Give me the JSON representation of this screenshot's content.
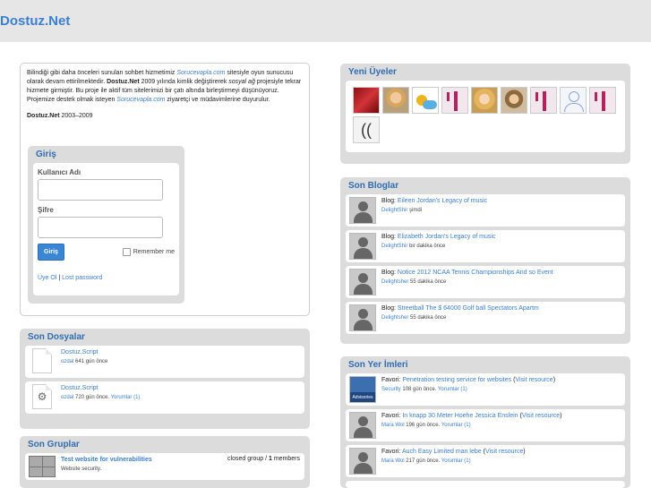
{
  "site": {
    "title": "Dostuz.Net"
  },
  "intro": {
    "p1_a": "Bilindiği gibi daha önceleri sunulan sohbet hizmetimiz ",
    "p1_link1": "Sorucevapla.com",
    "p1_b": " sitesiyle oyun sunucusu olarak devam ettirilmektedir. ",
    "p1_bold": "Dostuz.Net",
    "p1_c": " 2009 yılında kimlik değiştirerek ",
    "p1_em": "sosyal ağ",
    "p1_d": " projesiyle tekrar hizmete girmiştir. Bu proje ile aktif tüm sitelerimizi bir çatı altında birleştirmeyi düşünüyoruz. Projemize destek olmak isteyen ",
    "p1_link2": "Sorucevapla.com",
    "p1_e": " ziyaretçi ve müdavimlerine duyurulur.",
    "sig_bold": "Dostuz.Net",
    "sig_years": " 2003–2009"
  },
  "login": {
    "title": "Giriş",
    "username_label": "Kullanıcı Adı",
    "password_label": "Şifre",
    "button": "Giriş",
    "remember": "Remember me",
    "register": "Üye Ol",
    "sep": " | ",
    "lost": "Lost password"
  },
  "files": {
    "title": "Son Dosyalar",
    "items": [
      {
        "name": "Dostuz.Script",
        "user": "ozdal",
        "time": " 641 gün önce",
        "comments": ""
      },
      {
        "name": "Dostuz.Script",
        "user": "ozdal",
        "time": " 720 gün önce. ",
        "comments": "Yorumlar (1)"
      }
    ]
  },
  "groups": {
    "title": "Son Gruplar",
    "items": [
      {
        "name": "Test website for vulnerabilities",
        "desc": "Website security.",
        "status": "closed group / ",
        "members_count": "1",
        "members_label": " members"
      }
    ]
  },
  "new_users": {
    "title": "Yeni Üyeler",
    "avatars": [
      "red-avatar",
      "woman-avatar",
      "sun-cloud-avatar",
      "pink-logo-avatar",
      "blonde-woman-avatar",
      "man-avatar",
      "pink-logo-avatar",
      "default-user-avatar",
      "pink-logo-avatar",
      "ear-avatar"
    ]
  },
  "blogs": {
    "title": "Son Bloglar",
    "items": [
      {
        "prefix": "Blog: ",
        "title": "Eileen Jordan's Legacy of music",
        "user": "DelightShir",
        "time": " şimdi"
      },
      {
        "prefix": "Blog: ",
        "title": "Elizabeth Jordan's Legacy of music",
        "user": "DelightShir",
        "time": " bir dakika önce"
      },
      {
        "prefix": "Blog: ",
        "title": "Notice 2012 NCAA Tennis Championships And so Event",
        "user": "Delightsher",
        "time": " 55 dakika önce"
      },
      {
        "prefix": "Blog: ",
        "title": "Streetball The $ 64000 Golf ball Spectators Apartm",
        "user": "Delightsher",
        "time": " 55 dakika önce"
      }
    ]
  },
  "bookmarks": {
    "title": "Son Yer İmleri",
    "thumb_label": "Advisories",
    "items": [
      {
        "prefix": "Favori: ",
        "title": "Penetration testing service for websites",
        "visit": "Visit resource",
        "user": "Security",
        "time": " 108 gün önce. ",
        "comments": "Yorumlar (1)"
      },
      {
        "prefix": "Favori: ",
        "title": "In knapp 30 Meter Hoehe Jessica Enslein",
        "visit": "Visit resource",
        "user": "Mara Wol",
        "time": " 196 gün önce. ",
        "comments": "Yorumlar (1)"
      },
      {
        "prefix": "Favori: ",
        "title": "Auch Easy Limited man lebe",
        "visit": "Visit resource",
        "user": "Mara Wol",
        "time": " 217 gün önce. ",
        "comments": "Yorumlar (1)"
      }
    ]
  }
}
